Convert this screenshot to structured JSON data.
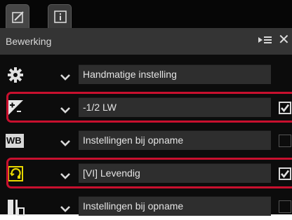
{
  "tabs": [
    {
      "icon": "edit-icon"
    },
    {
      "icon": "info-icon"
    }
  ],
  "panel": {
    "title": "Bewerking",
    "menu_icon": "panel-menu-icon",
    "close_icon": "close-icon"
  },
  "rows": [
    {
      "icon": "gear-icon",
      "value": "Handmatige instelling",
      "checked": null
    },
    {
      "icon": "exposure-compensation-icon",
      "value": "-1/2 LW",
      "checked": true,
      "highlighted": true
    },
    {
      "icon": "white-balance-icon",
      "icon_text": "WB",
      "value": "Instellingen bij opname",
      "checked": false
    },
    {
      "icon": "picture-control-icon",
      "value": "[VI] Levendig",
      "checked": true,
      "highlighted": true
    },
    {
      "icon": "tone-icon",
      "value": "Instellingen bij opname",
      "checked": false
    }
  ],
  "colors": {
    "highlight": "#c8102e",
    "icon_yellow": "#e8d800"
  }
}
